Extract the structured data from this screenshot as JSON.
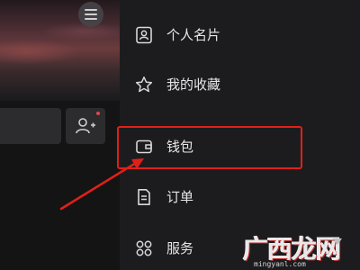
{
  "drawer": {
    "items": [
      {
        "label": "个人名片",
        "icon": "id-card-icon"
      },
      {
        "label": "我的收藏",
        "icon": "star-icon"
      },
      {
        "label": "钱包",
        "icon": "wallet-icon"
      },
      {
        "label": "订单",
        "icon": "order-icon"
      },
      {
        "label": "服务",
        "icon": "grid-icon"
      }
    ]
  },
  "annotation": {
    "highlight_color": "#e0201a"
  },
  "watermark": {
    "text": "广西龙网",
    "domain": "mingyanl.com"
  }
}
